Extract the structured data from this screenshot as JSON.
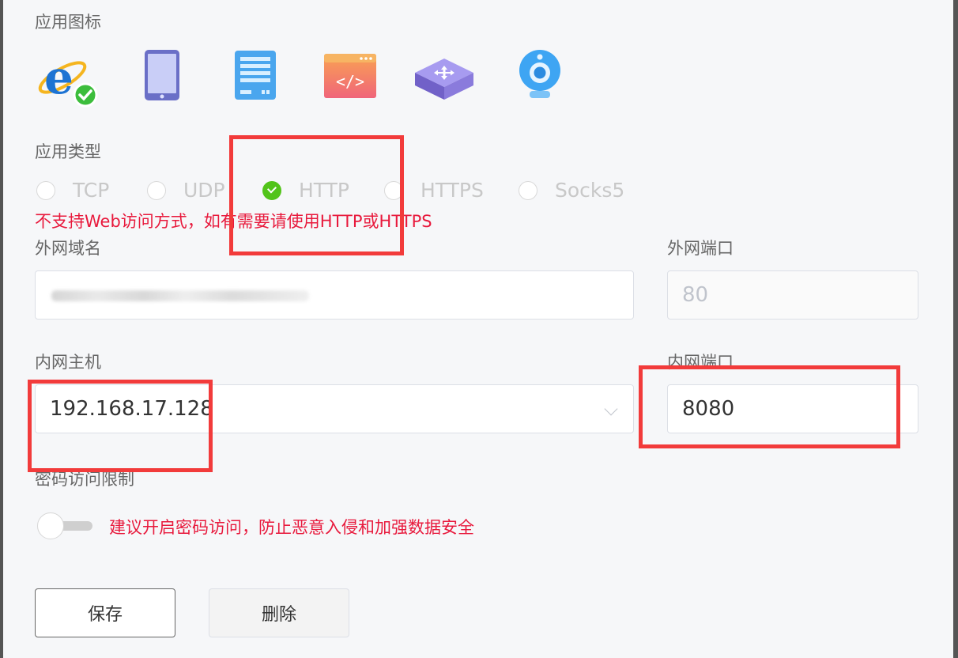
{
  "app_icon": {
    "label": "应用图标",
    "icons": [
      {
        "name": "ie-browser-icon",
        "selected": true
      },
      {
        "name": "tablet-icon"
      },
      {
        "name": "server-icon"
      },
      {
        "name": "code-window-icon"
      },
      {
        "name": "network-switch-icon"
      },
      {
        "name": "webcam-icon"
      }
    ]
  },
  "app_type": {
    "label": "应用类型",
    "options": [
      "TCP",
      "UDP",
      "HTTP",
      "HTTPS",
      "Socks5"
    ],
    "selected": "HTTP",
    "warning": "不支持Web访问方式，如有需要请使用HTTP或HTTPS"
  },
  "external_domain": {
    "label": "外网域名",
    "value": ""
  },
  "external_port": {
    "label": "外网端口",
    "value": "80"
  },
  "internal_host": {
    "label": "内网主机",
    "value": "192.168.17.128"
  },
  "internal_port": {
    "label": "内网端口",
    "value": "8080"
  },
  "password_limit": {
    "label": "密码访问限制",
    "enabled": false,
    "hint": "建议开启密码访问，防止恶意入侵和加强数据安全"
  },
  "buttons": {
    "save": "保存",
    "delete": "删除"
  },
  "colors": {
    "warning_text": "#e8193c",
    "checked_green": "#52c41a",
    "highlight_red": "#f23b3b"
  }
}
